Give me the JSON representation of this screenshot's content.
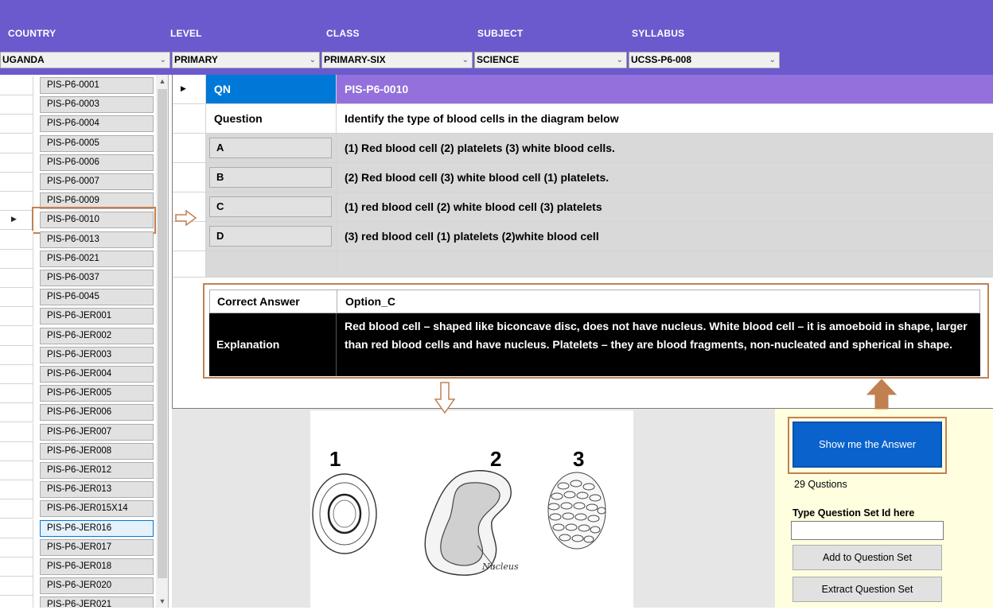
{
  "filters": {
    "labels": [
      "COUNTRY",
      "LEVEL",
      "CLASS",
      "SUBJECT",
      "SYLLABUS"
    ],
    "values": [
      "UGANDA",
      "PRIMARY",
      "PRIMARY-SIX",
      "SCIENCE",
      "UCSS-P6-008"
    ]
  },
  "list": {
    "items": [
      "PIS-P6-0001",
      "PIS-P6-0003",
      "PIS-P6-0004",
      "PIS-P6-0005",
      "PIS-P6-0006",
      "PIS-P6-0007",
      "PIS-P6-0009",
      "PIS-P6-0010",
      "PIS-P6-0013",
      "PIS-P6-0021",
      "PIS-P6-0037",
      "PIS-P6-0045",
      "PIS-P6-JER001",
      "PIS-P6-JER002",
      "PIS-P6-JER003",
      "PIS-P6-JER004",
      "PIS-P6-JER005",
      "PIS-P6-JER006",
      "PIS-P6-JER007",
      "PIS-P6-JER008",
      "PIS-P6-JER012",
      "PIS-P6-JER013",
      "PIS-P6-JER015X14",
      "PIS-P6-JER016",
      "PIS-P6-JER017",
      "PIS-P6-JER018",
      "PIS-P6-JER020",
      "PIS-P6-JER021"
    ],
    "selected_item": "PIS-P6-0010",
    "focused_item": "PIS-P6-JER016"
  },
  "question": {
    "qn_label": "QN",
    "qn_value": "PIS-P6-0010",
    "question_label": "Question",
    "question_text": "Identify the type of blood cells in the diagram below",
    "options": [
      {
        "key": "A",
        "text": "(1) Red blood cell (2) platelets (3) white blood cells."
      },
      {
        "key": "B",
        "text": "(2) Red blood cell (3) white blood cell (1) platelets."
      },
      {
        "key": "C",
        "text": "(1) red  blood cell (2) white blood cell (3) platelets"
      },
      {
        "key": "D",
        "text": "(3) red blood cell (1) platelets (2)white blood cell"
      }
    ]
  },
  "answer": {
    "correct_label": "Correct Answer",
    "correct_value": "Option_C",
    "explanation_label": "Explanation",
    "explanation_text": "Red blood cell – shaped like biconcave disc, does not have nucleus. White blood cell – it is amoeboid in shape, larger than red blood cells and have nucleus. Platelets – they are blood fragments, non-nucleated and spherical in shape."
  },
  "diagram": {
    "labels": [
      "1",
      "2",
      "3"
    ],
    "nucleus_label": "Nucleus"
  },
  "side_panel": {
    "show_answer_label": "Show me the Answer",
    "count_text": "29 Qustions",
    "question_set_label": "Type Question Set Id here",
    "question_set_value": "",
    "add_label": "Add to Question Set",
    "extract_label": "Extract Question Set"
  },
  "colors": {
    "header_bg": "#6a5acd",
    "qn_key_bg": "#0078d7",
    "qn_val_bg": "#9370db",
    "show_btn_bg": "#0a63cc",
    "annotation": "#c28150",
    "side_panel_bg": "#ffffe0"
  }
}
